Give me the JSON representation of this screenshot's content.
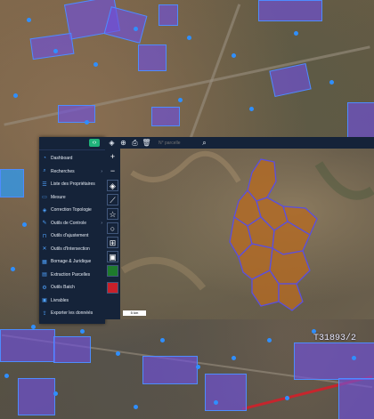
{
  "sidebar": {
    "toggle_icon": "collapse-icon",
    "items": [
      {
        "label": "Dashboard",
        "icon": "dashboard-icon",
        "has_children": false
      },
      {
        "label": "Recherches",
        "icon": "search-icon",
        "has_children": true
      },
      {
        "label": "Liste des Propriétaires",
        "icon": "list-icon",
        "has_children": false
      },
      {
        "label": "Mesure",
        "icon": "ruler-icon",
        "has_children": false
      },
      {
        "label": "Correction Topologie",
        "icon": "topology-icon",
        "has_children": false
      },
      {
        "label": "Outils de Controle",
        "icon": "wrench-icon",
        "has_children": true
      },
      {
        "label": "Outils d'ajustement",
        "icon": "adjust-icon",
        "has_children": false
      },
      {
        "label": "Outils d'Intersection",
        "icon": "intersection-icon",
        "has_children": false
      },
      {
        "label": "Bornage & Juridique",
        "icon": "boundary-icon",
        "has_children": false
      },
      {
        "label": "Extraction Parcelles",
        "icon": "extract-icon",
        "has_children": false
      },
      {
        "label": "Outils Batch",
        "icon": "batch-icon",
        "has_children": false
      },
      {
        "label": "Livrables",
        "icon": "deliverable-icon",
        "has_children": false
      },
      {
        "label": "Exporter les donnéés",
        "icon": "export-icon",
        "has_children": false
      }
    ]
  },
  "topbar": {
    "search_placeholder": "N° parcelle",
    "icons": [
      "layers-icon",
      "zoom-icon",
      "print-icon",
      "delete-icon",
      "search-icon"
    ]
  },
  "map_tools": [
    "zoom-in-icon",
    "zoom-out-icon",
    "navigate-icon",
    "draw-line-icon",
    "draw-polygon-icon",
    "draw-circle-icon",
    "measure-icon",
    "layer-green-icon",
    "layer-red-icon"
  ],
  "scale": {
    "label": "5 km"
  },
  "background_label": "T31893/2",
  "colors": {
    "panel": "#152339",
    "accent_green": "#1fb37a",
    "parcel": "#b26a24",
    "parcel_border": "#5a4fe0"
  }
}
